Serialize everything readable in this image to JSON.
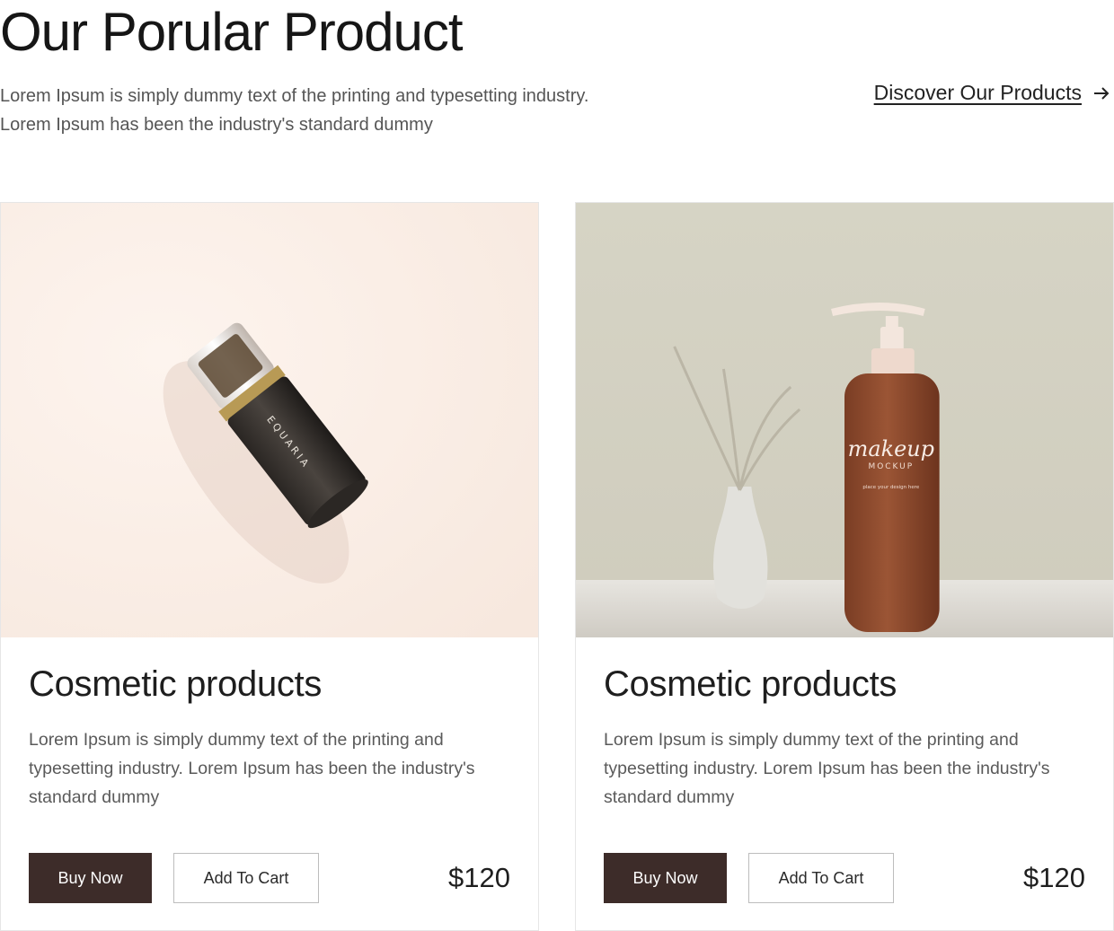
{
  "header": {
    "title": "Our Porular Product",
    "description": "Lorem Ipsum is simply dummy text of the printing and typesetting industry. Lorem Ipsum has been the industry's standard dummy",
    "discover_link": "Discover Our Products",
    "discover_icon": "arrow-right-icon"
  },
  "products": [
    {
      "image": "serum-bottle-image",
      "image_label": "EQUARIA",
      "title": "Cosmetic products",
      "description": "Lorem Ipsum is simply dummy text of the printing and typesetting industry. Lorem Ipsum has been the industry's standard dummy",
      "buy_label": "Buy Now",
      "cart_label": "Add To Cart",
      "price": "$120"
    },
    {
      "image": "pump-bottle-image",
      "image_label": "makeup",
      "image_sublabel": "MOCKUP",
      "image_tagline": "place your design here",
      "title": "Cosmetic products",
      "description": "Lorem Ipsum is simply dummy text of the printing and typesetting industry. Lorem Ipsum has been the industry's standard dummy",
      "buy_label": "Buy Now",
      "cart_label": "Add To Cart",
      "price": "$120"
    }
  ],
  "colors": {
    "buy_button": "#3d2c29",
    "card_border": "#e6e6e6",
    "image1_bg": "#f9ece4",
    "image2_bg": "#d9d6c8",
    "bottle2": "#8a4a2e"
  }
}
